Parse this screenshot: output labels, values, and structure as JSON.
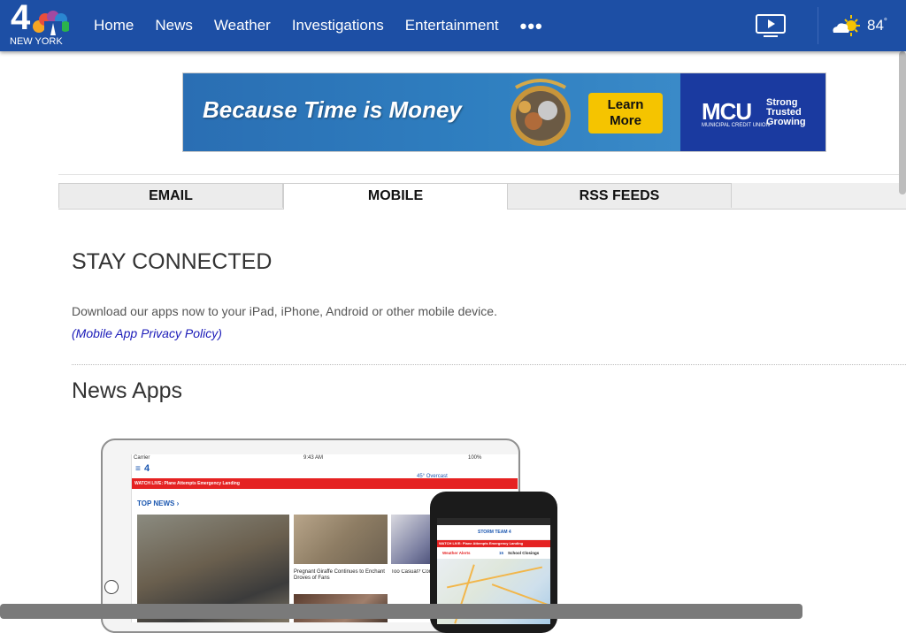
{
  "header": {
    "logo": {
      "number": "4",
      "city": "NEW YORK"
    },
    "nav": [
      "Home",
      "News",
      "Weather",
      "Investigations",
      "Entertainment"
    ],
    "more": "•••",
    "video_icon": "video-play-icon",
    "weather": {
      "icon": "partly-sunny-icon",
      "temp": "84",
      "degree": "°"
    },
    "color": "#1d4fa5"
  },
  "ad": {
    "headline": "Because Time is Money",
    "cta_line1": "Learn",
    "cta_line2": "More",
    "brand": "MCU",
    "tagline": [
      "Strong",
      "Trusted",
      "Growing"
    ],
    "brand_sub": "MUNICIPAL CREDIT UNION"
  },
  "tabs": [
    {
      "label": "EMAIL",
      "active": false
    },
    {
      "label": "MOBILE",
      "active": true
    },
    {
      "label": "RSS FEEDS",
      "active": false
    }
  ],
  "content": {
    "heading": "STAY CONNECTED",
    "description": "Download our apps now to your iPad, iPhone, Android or other mobile device.",
    "privacy_link": "(Mobile App Privacy Policy)",
    "section_title": "News Apps"
  },
  "tablet": {
    "carrier": "Carrier",
    "time": "9:43 AM",
    "battery": "100%",
    "weather": "45° Overcast",
    "live_banner": "WATCH LIVE: Plane Attempts Emergency Landing",
    "top_news": "TOP NEWS ›",
    "caption2": "Pregnant Giraffe Continues to Enchant Droves of Fans",
    "caption3": "Too Casual? Conw Kneel Sparks Deb"
  },
  "phone": {
    "live_banner": "WATCH LIVE: Plane Attempts Emergency Landing",
    "tab1": "Weather Alerts",
    "tab2": "School Closings",
    "tab2_count": "15",
    "logo": "STORM TEAM 4"
  }
}
